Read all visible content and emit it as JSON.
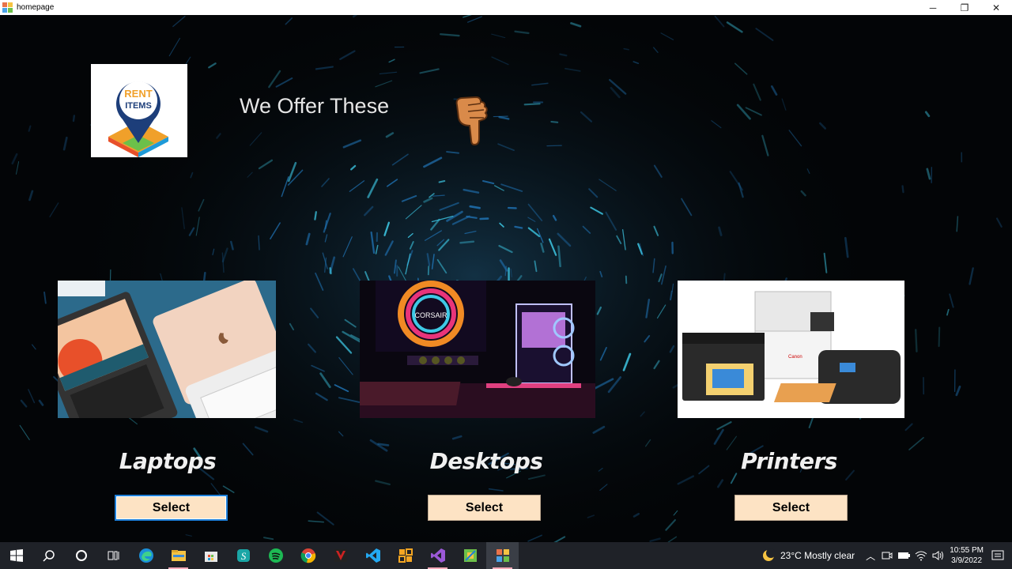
{
  "window": {
    "title": "homepage",
    "controls": [
      "─",
      "❐",
      "✕"
    ]
  },
  "header": {
    "headline": "We Offer These",
    "logo_text": [
      "RENT",
      "ITEMS"
    ]
  },
  "categories": [
    {
      "label": "Laptops",
      "button": "Select"
    },
    {
      "label": "Desktops",
      "button": "Select"
    },
    {
      "label": "Printers",
      "button": "Select"
    }
  ],
  "desktop_monitor_brand": "CORSAIR",
  "printer_brand": "Canon",
  "taskbar": {
    "apps": [
      "start-icon",
      "search-icon",
      "cortana-icon",
      "task-view-icon",
      "edge-icon",
      "file-explorer-icon",
      "store-icon",
      "app-s-icon",
      "spotify-icon",
      "chrome-icon",
      "game-icon",
      "vscode-icon",
      "app-orange-icon",
      "visual-studio-icon",
      "app-green-icon",
      "homepage-app-icon"
    ],
    "weather": "23°C  Mostly clear",
    "time": "10:55 PM",
    "date": "3/9/2022"
  },
  "colors": {
    "button_bg": "#fde3c4",
    "accent": "#1e7fd8",
    "streak": "#3ec9e6"
  }
}
